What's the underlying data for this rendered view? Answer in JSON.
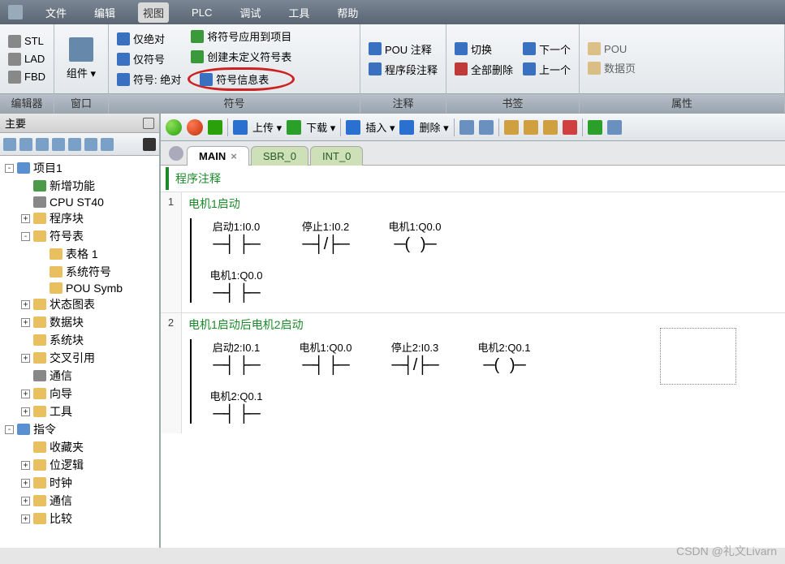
{
  "menubar": {
    "items": [
      "文件",
      "编辑",
      "视图",
      "PLC",
      "调试",
      "工具",
      "帮助"
    ],
    "active_index": 2
  },
  "ribbon": {
    "groups": [
      {
        "label": "编辑器",
        "items": [
          {
            "icon": "stl-icon",
            "text": "STL"
          },
          {
            "icon": "lad-icon",
            "text": "LAD"
          },
          {
            "icon": "fbd-icon",
            "text": "FBD"
          }
        ]
      },
      {
        "label": "窗口",
        "items": [
          {
            "icon": "component-icon",
            "text": "组件",
            "big": true,
            "dropdown": true
          }
        ]
      },
      {
        "label": "符号",
        "cols": [
          [
            {
              "icon": "vbx-icon",
              "text": "仅绝对"
            },
            {
              "icon": "vbx-icon",
              "text": "仅符号"
            },
            {
              "icon": "vbx-icon",
              "text": "符号: 绝对"
            }
          ],
          [
            {
              "icon": "apply-icon",
              "text": "将符号应用到项目"
            },
            {
              "icon": "create-icon",
              "text": "创建未定义符号表"
            },
            {
              "icon": "info-icon",
              "text": "符号信息表",
              "circled": true
            }
          ]
        ]
      },
      {
        "label": "注释",
        "cols": [
          [
            {
              "icon": "pou-comment-icon",
              "text": "POU 注释"
            },
            {
              "icon": "net-comment-icon",
              "text": "程序段注释"
            }
          ]
        ]
      },
      {
        "label": "书签",
        "cols": [
          [
            {
              "icon": "toggle-icon",
              "text": "切换"
            },
            {
              "icon": "delete-all-icon",
              "text": "全部删除"
            }
          ],
          [
            {
              "icon": "next-icon",
              "text": "下一个"
            },
            {
              "icon": "prev-icon",
              "text": "上一个"
            }
          ]
        ]
      },
      {
        "label": "属性",
        "cols": [
          [
            {
              "icon": "pou-icon",
              "text": "POU"
            },
            {
              "icon": "datapage-icon",
              "text": "数据页"
            }
          ]
        ]
      }
    ]
  },
  "sidebar": {
    "title": "主要",
    "tree": [
      {
        "level": 0,
        "exp": "-",
        "icon": "blue",
        "text": "项目1"
      },
      {
        "level": 1,
        "exp": "",
        "icon": "green",
        "text": "新增功能"
      },
      {
        "level": 1,
        "exp": "",
        "icon": "gray",
        "text": "CPU ST40"
      },
      {
        "level": 1,
        "exp": "+",
        "icon": "yellow",
        "text": "程序块"
      },
      {
        "level": 1,
        "exp": "-",
        "icon": "yellow",
        "text": "符号表"
      },
      {
        "level": 2,
        "exp": "",
        "icon": "yellow",
        "text": "表格 1"
      },
      {
        "level": 2,
        "exp": "",
        "icon": "yellow",
        "text": "系统符号"
      },
      {
        "level": 2,
        "exp": "",
        "icon": "yellow",
        "text": "POU Symb"
      },
      {
        "level": 1,
        "exp": "+",
        "icon": "yellow",
        "text": "状态图表"
      },
      {
        "level": 1,
        "exp": "+",
        "icon": "yellow",
        "text": "数据块"
      },
      {
        "level": 1,
        "exp": "",
        "icon": "yellow",
        "text": "系统块"
      },
      {
        "level": 1,
        "exp": "+",
        "icon": "yellow",
        "text": "交叉引用"
      },
      {
        "level": 1,
        "exp": "",
        "icon": "gray",
        "text": "通信"
      },
      {
        "level": 1,
        "exp": "+",
        "icon": "yellow",
        "text": "向导"
      },
      {
        "level": 1,
        "exp": "+",
        "icon": "yellow",
        "text": "工具"
      },
      {
        "level": 0,
        "exp": "-",
        "icon": "blue",
        "text": "指令"
      },
      {
        "level": 1,
        "exp": "",
        "icon": "yellow",
        "text": "收藏夹"
      },
      {
        "level": 1,
        "exp": "+",
        "icon": "yellow",
        "text": "位逻辑"
      },
      {
        "level": 1,
        "exp": "+",
        "icon": "yellow",
        "text": "时钟"
      },
      {
        "level": 1,
        "exp": "+",
        "icon": "yellow",
        "text": "通信"
      },
      {
        "level": 1,
        "exp": "+",
        "icon": "yellow",
        "text": "比较"
      }
    ]
  },
  "toolbar": {
    "upload": "上传",
    "download": "下载",
    "insert": "插入",
    "delete": "删除"
  },
  "tabs": {
    "items": [
      {
        "label": "MAIN",
        "active": true,
        "closable": true
      },
      {
        "label": "SBR_0",
        "sub": true
      },
      {
        "label": "INT_0",
        "sub": true
      }
    ]
  },
  "program": {
    "header": "程序注释",
    "networks": [
      {
        "num": "1",
        "title": "电机1启动",
        "rows": [
          [
            {
              "label": "启动1:I0.0",
              "sym": "─┤ ├─"
            },
            {
              "label": "停止1:I0.2",
              "sym": "─┤/├─"
            },
            {
              "label": "电机1:Q0.0",
              "sym": "─(   )─"
            }
          ],
          [
            {
              "label": "电机1:Q0.0",
              "sym": "─┤ ├─"
            }
          ]
        ]
      },
      {
        "num": "2",
        "title": "电机1启动后电机2启动",
        "rows": [
          [
            {
              "label": "启动2:I0.1",
              "sym": "─┤ ├─"
            },
            {
              "label": "电机1:Q0.0",
              "sym": "─┤ ├─"
            },
            {
              "label": "停止2:I0.3",
              "sym": "─┤/├─"
            },
            {
              "label": "电机2:Q0.1",
              "sym": "─(   )─"
            }
          ],
          [
            {
              "label": "电机2:Q0.1",
              "sym": "─┤ ├─"
            }
          ]
        ]
      }
    ]
  },
  "watermark": "CSDN @礼文Livarn"
}
